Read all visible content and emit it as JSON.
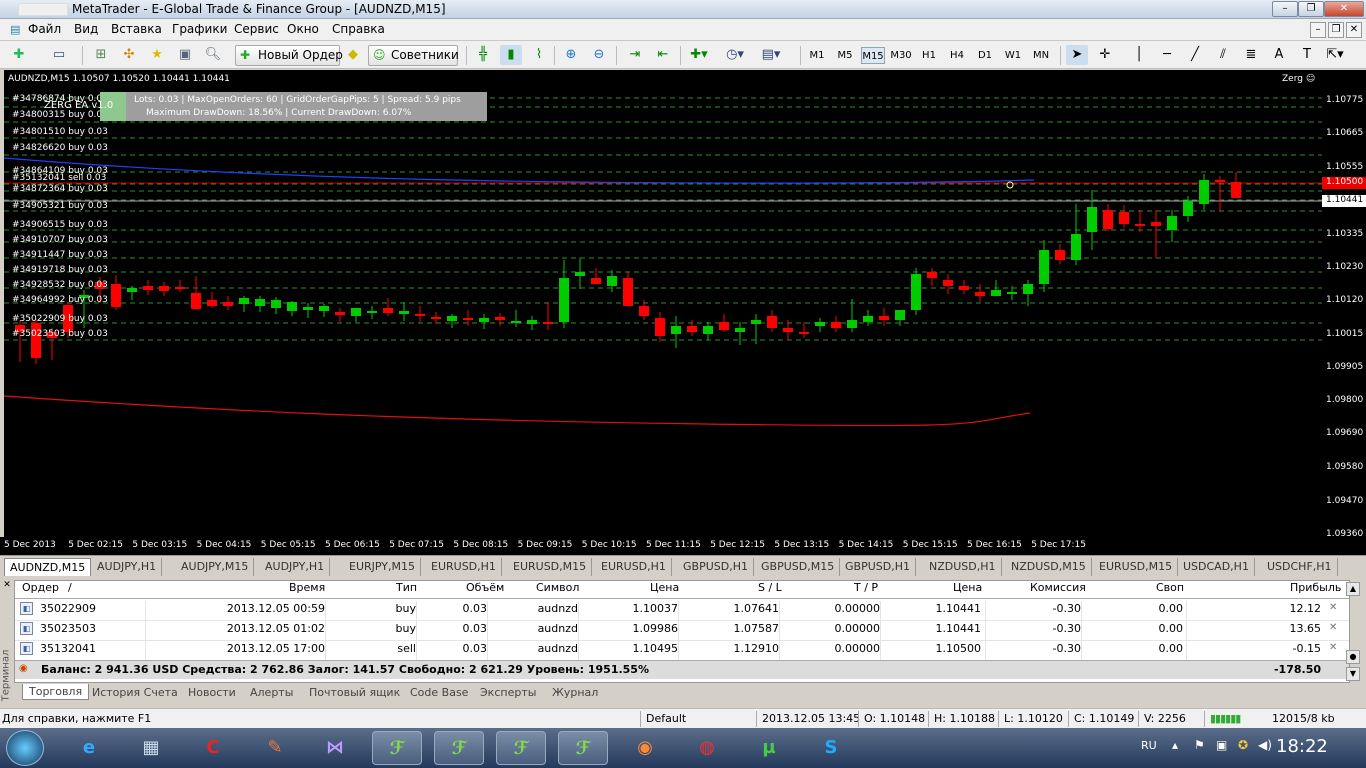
{
  "window": {
    "title": "MetaTrader - E-Global Trade & Finance Group - [AUDNZD,M15]"
  },
  "menu": [
    "Файл",
    "Вид",
    "Вставка",
    "Графики",
    "Сервис",
    "Окно",
    "Справка"
  ],
  "toolbar": {
    "new_order": "Новый Ордер",
    "experts": "Советники",
    "timeframes": [
      "M1",
      "M5",
      "M15",
      "M30",
      "H1",
      "H4",
      "D1",
      "W1",
      "MN"
    ],
    "selected_timeframe": "M15"
  },
  "chart": {
    "header": "AUDNZD,M15  1.10507 1.10520 1.10441 1.10441",
    "expert": "Zerg",
    "overlay_label": "ZERG EA v1.0",
    "info": {
      "line1": "Lots: 0.03   |   MaxOpenOrders: 60   |   GridOrderGapPips: 5   |   Spread: 5.9 pips",
      "line2": "Maximum DrawDown: 18.56%   |   Current DrawDown: 6.07%"
    },
    "order_labels": [
      "#34786874 buy 0.03",
      "#34800315 buy 0.03",
      "#34801510 buy 0.03",
      "#34826620 buy 0.03",
      "#34864109 buy 0.03",
      "#35132041 sell 0.03",
      "#34872364 buy 0.03",
      "#34905321 buy 0.03",
      "#34906515 buy 0.03",
      "#34910707 buy 0.03",
      "#34911447 buy 0.03",
      "#34919718 buy 0.03",
      "#34928532 buy 0.03",
      "#34964992 buy 0.03",
      "#35022909 buy 0.03",
      "#35023503 buy 0.03"
    ],
    "price_ticks": [
      "1.10775",
      "1.10665",
      "1.10555",
      "1.10445",
      "1.10335",
      "1.10230",
      "1.10120",
      "1.10015",
      "1.09905",
      "1.09800",
      "1.09690",
      "1.09580",
      "1.09470",
      "1.09360"
    ],
    "bid_label": "1.10500",
    "ask_label": "1.10441",
    "time_ticks": [
      "5 Dec 2013",
      "5 Dec 02:15",
      "5 Dec 03:15",
      "5 Dec 04:15",
      "5 Dec 05:15",
      "5 Dec 06:15",
      "5 Dec 07:15",
      "5 Dec 08:15",
      "5 Dec 09:15",
      "5 Dec 10:15",
      "5 Dec 11:15",
      "5 Dec 12:15",
      "5 Dec 13:15",
      "5 Dec 14:15",
      "5 Dec 15:15",
      "5 Dec 16:15",
      "5 Dec 17:15"
    ],
    "colors": {
      "bull": "#00cc00",
      "bear": "#ff0000",
      "grid": "#2e8b2e",
      "ma_fast": "#2040ff",
      "ma_slow": "#e01010"
    }
  },
  "symbol_tabs": [
    "AUDNZD,M15",
    "AUDJPY,H1",
    "AUDJPY,M15",
    "AUDJPY,H1",
    "EURJPY,M15",
    "EURUSD,H1",
    "EURUSD,M15",
    "EURUSD,H1",
    "GBPUSD,H1",
    "GBPUSD,M15",
    "GBPUSD,H1",
    "NZDUSD,H1",
    "NZDUSD,M15",
    "EURUSD,M15",
    "USDCAD,H1",
    "USDCHF,H1"
  ],
  "terminal": {
    "headers": [
      "Ордер",
      "/",
      "Время",
      "Тип",
      "Объём",
      "Символ",
      "Цена",
      "S / L",
      "T / P",
      "Цена",
      "Комиссия",
      "Своп",
      "Прибыль"
    ],
    "rows": [
      {
        "order": "35022909",
        "time": "2013.12.05 00:59",
        "type": "buy",
        "volume": "0.03",
        "symbol": "audnzd",
        "price": "1.10037",
        "sl": "1.07641",
        "tp": "0.00000",
        "cur": "1.10441",
        "commission": "-0.30",
        "swap": "0.00",
        "profit": "12.12"
      },
      {
        "order": "35023503",
        "time": "2013.12.05 01:02",
        "type": "buy",
        "volume": "0.03",
        "symbol": "audnzd",
        "price": "1.09986",
        "sl": "1.07587",
        "tp": "0.00000",
        "cur": "1.10441",
        "commission": "-0.30",
        "swap": "0.00",
        "profit": "13.65"
      },
      {
        "order": "35132041",
        "time": "2013.12.05 17:00",
        "type": "sell",
        "volume": "0.03",
        "symbol": "audnzd",
        "price": "1.10495",
        "sl": "1.12910",
        "tp": "0.00000",
        "cur": "1.10500",
        "commission": "-0.30",
        "swap": "0.00",
        "profit": "-0.15"
      }
    ],
    "balance_line": "Баланс: 2 941.36 USD  Средства: 2 762.86  Залог: 141.57  Свободно: 2 621.29  Уровень: 1951.55%",
    "total_profit": "-178.50",
    "side_label": "Терминал",
    "tabs": [
      "Торговля",
      "История Счета",
      "Новости",
      "Алерты",
      "Почтовый ящик",
      "Code Base",
      "Эксперты",
      "Журнал"
    ]
  },
  "status": {
    "help": "Для справки, нажмите F1",
    "profile": "Default",
    "datetime": "2013.12.05 13:45",
    "o": "O: 1.10148",
    "h": "H: 1.10188",
    "l": "L: 1.10120",
    "c": "C: 1.10149",
    "v": "V: 2256",
    "traffic": "12015/8 kb"
  },
  "taskbar": {
    "lang": "RU",
    "clock": "18:22"
  }
}
